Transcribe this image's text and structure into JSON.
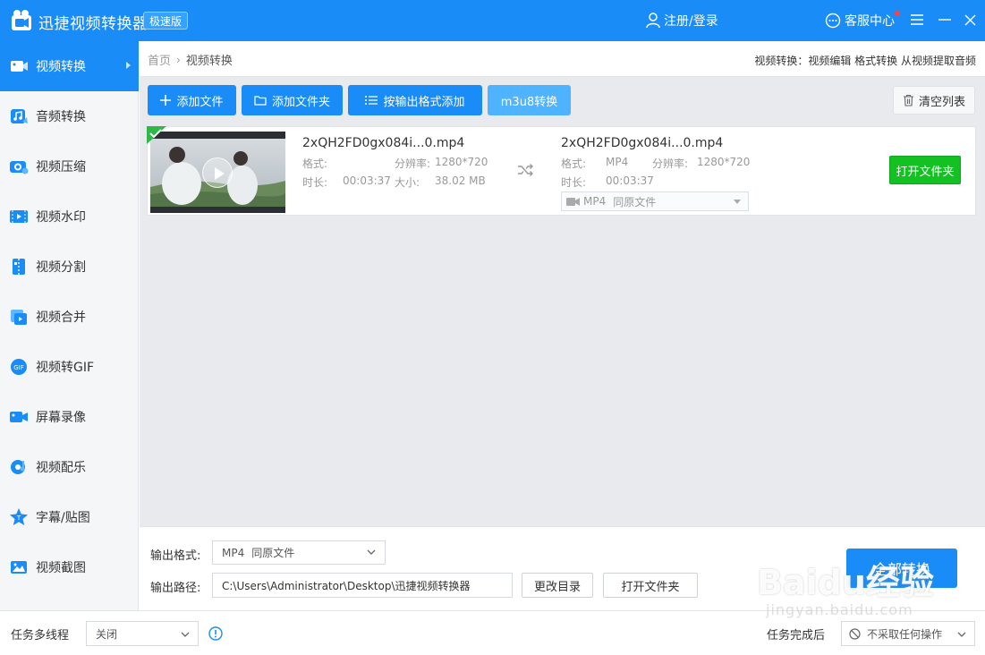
{
  "titlebar": {
    "app_title": "迅捷视频转换器",
    "edition": "极速版",
    "login": "注册/登录",
    "service": "客服中心"
  },
  "sidebar": {
    "items": [
      {
        "label": "视频转换",
        "icon": "video-convert-icon"
      },
      {
        "label": "音频转换",
        "icon": "audio-convert-icon"
      },
      {
        "label": "视频压缩",
        "icon": "video-compress-icon"
      },
      {
        "label": "视频水印",
        "icon": "video-watermark-icon"
      },
      {
        "label": "视频分割",
        "icon": "video-split-icon"
      },
      {
        "label": "视频合并",
        "icon": "video-merge-icon"
      },
      {
        "label": "视频转GIF",
        "icon": "video-gif-icon"
      },
      {
        "label": "屏幕录像",
        "icon": "screen-record-icon"
      },
      {
        "label": "视频配乐",
        "icon": "video-music-icon"
      },
      {
        "label": "字幕/贴图",
        "icon": "subtitle-sticker-icon"
      },
      {
        "label": "视频截图",
        "icon": "video-screenshot-icon"
      }
    ]
  },
  "breadcrumb": {
    "home": "首页",
    "current": "视频转换",
    "feature_desc": "视频转换：视频编辑 格式转换 从视频提取音频"
  },
  "toolbar": {
    "add_file": "添加文件",
    "add_folder": "添加文件夹",
    "add_by_format": "按输出格式添加",
    "m3u8": "m3u8转换",
    "clear_list": "清空列表"
  },
  "file": {
    "src_name": "2xQH2FD0gx084i...0.mp4",
    "src_format_label": "格式:",
    "src_format": "",
    "src_resolution_label": "分辨率:",
    "src_resolution": "1280*720",
    "src_duration_label": "时长:",
    "src_duration": "00:03:37",
    "src_size_label": "大小:",
    "src_size": "38.02 MB",
    "dst_name": "2xQH2FD0gx084i...0.mp4",
    "dst_format_label": "格式:",
    "dst_format": "MP4",
    "dst_resolution_label": "分辨率:",
    "dst_resolution": "1280*720",
    "dst_duration_label": "时长:",
    "dst_duration": "00:03:37",
    "out_format": "MP4",
    "out_quality": "同原文件",
    "open_folder": "打开文件夹"
  },
  "bottom": {
    "output_format_label": "输出格式:",
    "output_format": "MP4",
    "output_quality": "同原文件",
    "output_path_label": "输出路径:",
    "output_path": "C:\\Users\\Administrator\\Desktop\\迅捷视频转换器",
    "change_dir": "更改目录",
    "open_folder": "打开文件夹",
    "convert_all": "全部转换"
  },
  "status": {
    "multithread_label": "任务多线程",
    "multithread_value": "关闭",
    "after_done_label": "任务完成后",
    "after_done_value": "不采取任何操作"
  },
  "watermark": {
    "main": "Baidu经验",
    "sub": "jingyan.baidu.com"
  },
  "colors": {
    "primary": "#1a8cf7",
    "light_primary": "#4fb3ff",
    "green": "#13c122"
  }
}
